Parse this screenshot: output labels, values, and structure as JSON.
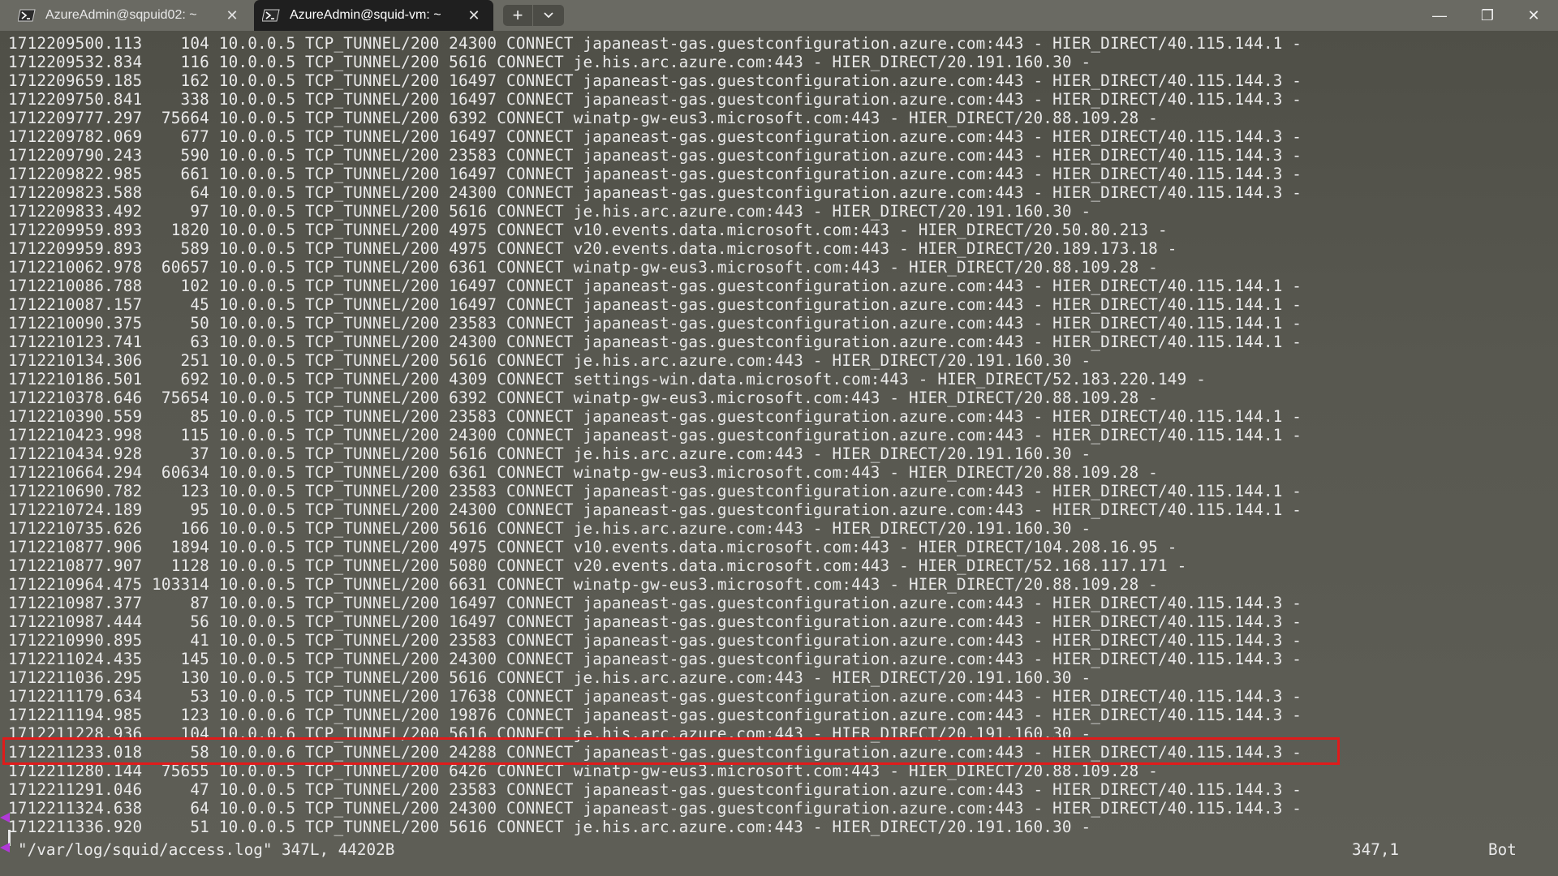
{
  "tabs": [
    {
      "label": "AzureAdmin@sqpuid02: ~",
      "active": false,
      "icon": "powershell-icon"
    },
    {
      "label": "AzureAdmin@squid-vm: ~",
      "active": true,
      "icon": "powershell-icon"
    }
  ],
  "tab_controls": {
    "new_tab": "+",
    "dropdown": "⌄"
  },
  "window_controls": {
    "minimize": "—",
    "maximize": "❐",
    "close": "✕"
  },
  "colors": {
    "highlight": "#e01b1b",
    "text": "#e9e9e9",
    "active_tab": "#1f1f1f"
  },
  "lines": [
    "1712209500.113    104 10.0.0.5 TCP_TUNNEL/200 24300 CONNECT japaneast-gas.guestconfiguration.azure.com:443 - HIER_DIRECT/40.115.144.1 -",
    "1712209532.834    116 10.0.0.5 TCP_TUNNEL/200 5616 CONNECT je.his.arc.azure.com:443 - HIER_DIRECT/20.191.160.30 -",
    "1712209659.185    162 10.0.0.5 TCP_TUNNEL/200 16497 CONNECT japaneast-gas.guestconfiguration.azure.com:443 - HIER_DIRECT/40.115.144.3 -",
    "1712209750.841    338 10.0.0.5 TCP_TUNNEL/200 16497 CONNECT japaneast-gas.guestconfiguration.azure.com:443 - HIER_DIRECT/40.115.144.3 -",
    "1712209777.297  75664 10.0.0.5 TCP_TUNNEL/200 6392 CONNECT winatp-gw-eus3.microsoft.com:443 - HIER_DIRECT/20.88.109.28 -",
    "1712209782.069    677 10.0.0.5 TCP_TUNNEL/200 16497 CONNECT japaneast-gas.guestconfiguration.azure.com:443 - HIER_DIRECT/40.115.144.3 -",
    "1712209790.243    590 10.0.0.5 TCP_TUNNEL/200 23583 CONNECT japaneast-gas.guestconfiguration.azure.com:443 - HIER_DIRECT/40.115.144.3 -",
    "1712209822.985    661 10.0.0.5 TCP_TUNNEL/200 16497 CONNECT japaneast-gas.guestconfiguration.azure.com:443 - HIER_DIRECT/40.115.144.3 -",
    "1712209823.588     64 10.0.0.5 TCP_TUNNEL/200 24300 CONNECT japaneast-gas.guestconfiguration.azure.com:443 - HIER_DIRECT/40.115.144.3 -",
    "1712209833.492     97 10.0.0.5 TCP_TUNNEL/200 5616 CONNECT je.his.arc.azure.com:443 - HIER_DIRECT/20.191.160.30 -",
    "1712209959.893   1820 10.0.0.5 TCP_TUNNEL/200 4975 CONNECT v10.events.data.microsoft.com:443 - HIER_DIRECT/20.50.80.213 -",
    "1712209959.893    589 10.0.0.5 TCP_TUNNEL/200 4975 CONNECT v20.events.data.microsoft.com:443 - HIER_DIRECT/20.189.173.18 -",
    "1712210062.978  60657 10.0.0.5 TCP_TUNNEL/200 6361 CONNECT winatp-gw-eus3.microsoft.com:443 - HIER_DIRECT/20.88.109.28 -",
    "1712210086.788    102 10.0.0.5 TCP_TUNNEL/200 16497 CONNECT japaneast-gas.guestconfiguration.azure.com:443 - HIER_DIRECT/40.115.144.1 -",
    "1712210087.157     45 10.0.0.5 TCP_TUNNEL/200 16497 CONNECT japaneast-gas.guestconfiguration.azure.com:443 - HIER_DIRECT/40.115.144.1 -",
    "1712210090.375     50 10.0.0.5 TCP_TUNNEL/200 23583 CONNECT japaneast-gas.guestconfiguration.azure.com:443 - HIER_DIRECT/40.115.144.1 -",
    "1712210123.741     63 10.0.0.5 TCP_TUNNEL/200 24300 CONNECT japaneast-gas.guestconfiguration.azure.com:443 - HIER_DIRECT/40.115.144.1 -",
    "1712210134.306    251 10.0.0.5 TCP_TUNNEL/200 5616 CONNECT je.his.arc.azure.com:443 - HIER_DIRECT/20.191.160.30 -",
    "1712210186.501    692 10.0.0.5 TCP_TUNNEL/200 4309 CONNECT settings-win.data.microsoft.com:443 - HIER_DIRECT/52.183.220.149 -",
    "1712210378.646  75654 10.0.0.5 TCP_TUNNEL/200 6392 CONNECT winatp-gw-eus3.microsoft.com:443 - HIER_DIRECT/20.88.109.28 -",
    "1712210390.559     85 10.0.0.5 TCP_TUNNEL/200 23583 CONNECT japaneast-gas.guestconfiguration.azure.com:443 - HIER_DIRECT/40.115.144.1 -",
    "1712210423.998    115 10.0.0.5 TCP_TUNNEL/200 24300 CONNECT japaneast-gas.guestconfiguration.azure.com:443 - HIER_DIRECT/40.115.144.1 -",
    "1712210434.928     37 10.0.0.5 TCP_TUNNEL/200 5616 CONNECT je.his.arc.azure.com:443 - HIER_DIRECT/20.191.160.30 -",
    "1712210664.294  60634 10.0.0.5 TCP_TUNNEL/200 6361 CONNECT winatp-gw-eus3.microsoft.com:443 - HIER_DIRECT/20.88.109.28 -",
    "1712210690.782    123 10.0.0.5 TCP_TUNNEL/200 23583 CONNECT japaneast-gas.guestconfiguration.azure.com:443 - HIER_DIRECT/40.115.144.1 -",
    "1712210724.189     95 10.0.0.5 TCP_TUNNEL/200 24300 CONNECT japaneast-gas.guestconfiguration.azure.com:443 - HIER_DIRECT/40.115.144.1 -",
    "1712210735.626    166 10.0.0.5 TCP_TUNNEL/200 5616 CONNECT je.his.arc.azure.com:443 - HIER_DIRECT/20.191.160.30 -",
    "1712210877.906   1894 10.0.0.5 TCP_TUNNEL/200 4975 CONNECT v10.events.data.microsoft.com:443 - HIER_DIRECT/104.208.16.95 -",
    "1712210877.907   1128 10.0.0.5 TCP_TUNNEL/200 5080 CONNECT v20.events.data.microsoft.com:443 - HIER_DIRECT/52.168.117.171 -",
    "1712210964.475 103314 10.0.0.5 TCP_TUNNEL/200 6631 CONNECT winatp-gw-eus3.microsoft.com:443 - HIER_DIRECT/20.88.109.28 -",
    "1712210987.377     87 10.0.0.5 TCP_TUNNEL/200 16497 CONNECT japaneast-gas.guestconfiguration.azure.com:443 - HIER_DIRECT/40.115.144.3 -",
    "1712210987.444     56 10.0.0.5 TCP_TUNNEL/200 16497 CONNECT japaneast-gas.guestconfiguration.azure.com:443 - HIER_DIRECT/40.115.144.3 -",
    "1712210990.895     41 10.0.0.5 TCP_TUNNEL/200 23583 CONNECT japaneast-gas.guestconfiguration.azure.com:443 - HIER_DIRECT/40.115.144.3 -",
    "1712211024.435    145 10.0.0.5 TCP_TUNNEL/200 24300 CONNECT japaneast-gas.guestconfiguration.azure.com:443 - HIER_DIRECT/40.115.144.3 -",
    "1712211036.295    130 10.0.0.5 TCP_TUNNEL/200 5616 CONNECT je.his.arc.azure.com:443 - HIER_DIRECT/20.191.160.30 -",
    "1712211179.634     53 10.0.0.5 TCP_TUNNEL/200 17638 CONNECT japaneast-gas.guestconfiguration.azure.com:443 - HIER_DIRECT/40.115.144.3 -",
    "1712211194.985    123 10.0.0.6 TCP_TUNNEL/200 19876 CONNECT japaneast-gas.guestconfiguration.azure.com:443 - HIER_DIRECT/40.115.144.3 -",
    "1712211228.936    104 10.0.0.6 TCP_TUNNEL/200 5616 CONNECT je.his.arc.azure.com:443 - HIER_DIRECT/20.191.160.30 -",
    "1712211233.018     58 10.0.0.6 TCP_TUNNEL/200 24288 CONNECT japaneast-gas.guestconfiguration.azure.com:443 - HIER_DIRECT/40.115.144.3 -",
    "1712211280.144  75655 10.0.0.5 TCP_TUNNEL/200 6426 CONNECT winatp-gw-eus3.microsoft.com:443 - HIER_DIRECT/20.88.109.28 -",
    "1712211291.046     47 10.0.0.5 TCP_TUNNEL/200 23583 CONNECT japaneast-gas.guestconfiguration.azure.com:443 - HIER_DIRECT/40.115.144.3 -",
    "1712211324.638     64 10.0.0.5 TCP_TUNNEL/200 24300 CONNECT japaneast-gas.guestconfiguration.azure.com:443 - HIER_DIRECT/40.115.144.3 -",
    "1712211336.920     51 10.0.0.5 TCP_TUNNEL/200 5616 CONNECT je.his.arc.azure.com:443 - HIER_DIRECT/20.191.160.30 -"
  ],
  "highlighted_line_index": 36,
  "status": {
    "file": "\"/var/log/squid/access.log\" 347L, 44202B",
    "position": "347,1",
    "scroll": "Bot"
  }
}
